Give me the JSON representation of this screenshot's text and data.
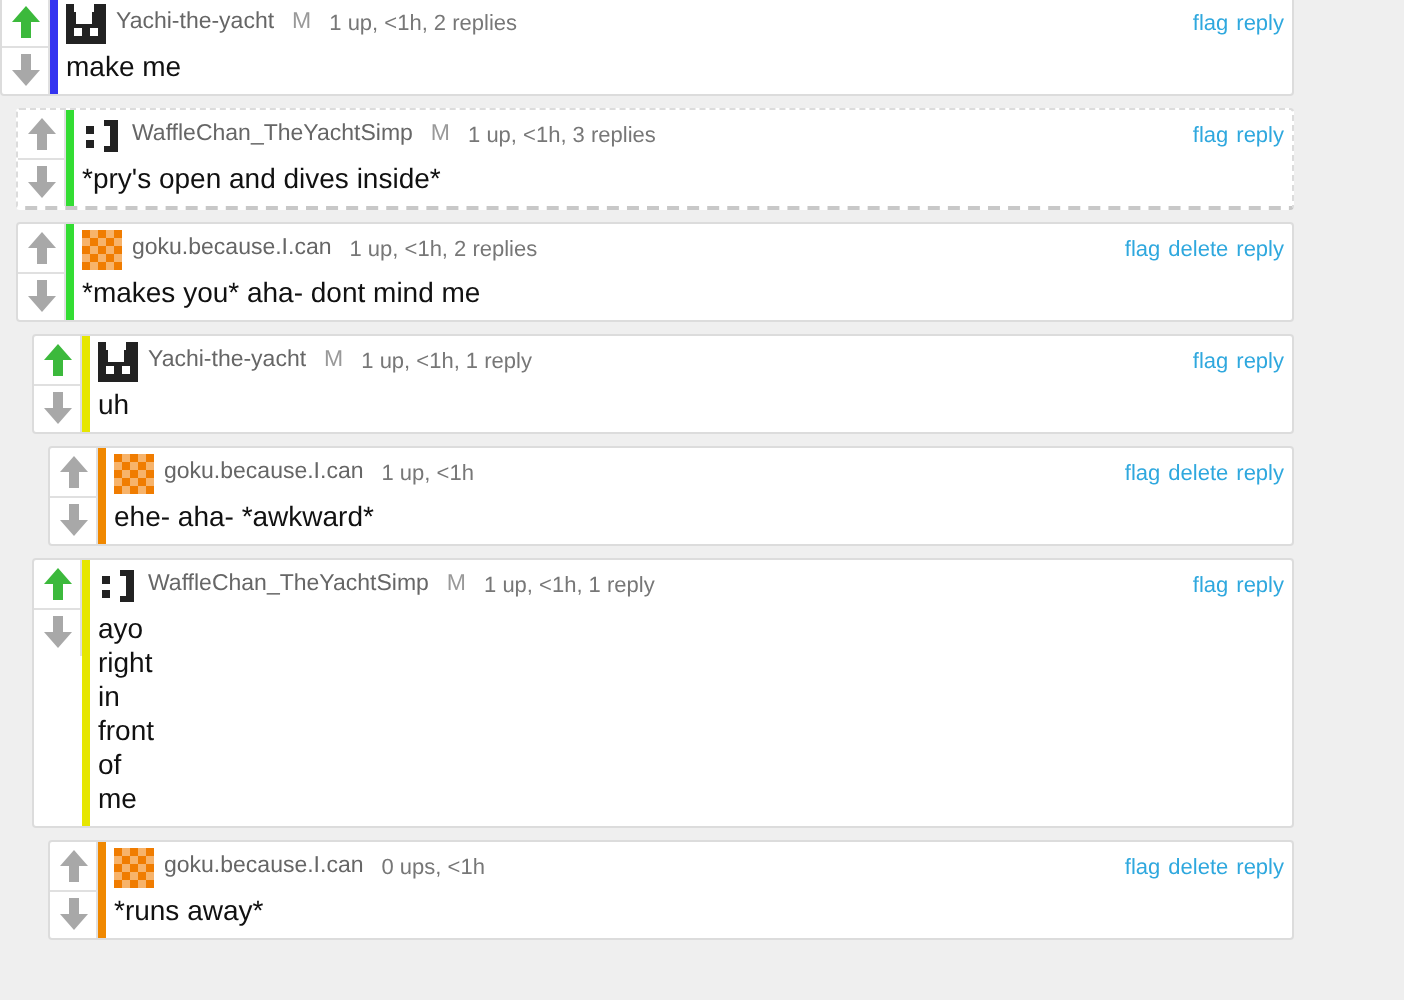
{
  "comments": [
    {
      "kind": "blocks",
      "user": "Yachi-the-yacht",
      "mod": "M",
      "meta": "1 up, <1h, 2 replies",
      "upvoted": true,
      "color": "#3434f0",
      "dashed": false,
      "actions": [
        "flag",
        "reply"
      ],
      "lines": [
        "make me"
      ],
      "children": [
        {
          "kind": "dots",
          "user": "WaffleChan_TheYachtSimp",
          "mod": "M",
          "meta": "1 up, <1h, 3 replies",
          "upvoted": false,
          "color": "#33dd33",
          "dashed": true,
          "actions": [
            "flag",
            "reply"
          ],
          "lines": [
            "*pry's open and dives inside*"
          ]
        },
        {
          "kind": "checker",
          "user": "goku.because.I.can",
          "meta": "1 up, <1h, 2 replies",
          "upvoted": false,
          "color": "#33dd33",
          "dashed": false,
          "actions": [
            "flag",
            "delete",
            "reply"
          ],
          "lines": [
            "*makes you* aha- dont mind me"
          ],
          "children": [
            {
              "kind": "blocks",
              "user": "Yachi-the-yacht",
              "mod": "M",
              "meta": "1 up, <1h, 1 reply",
              "upvoted": true,
              "color": "#e6e600",
              "dashed": false,
              "actions": [
                "flag",
                "reply"
              ],
              "lines": [
                "uh"
              ],
              "children": [
                {
                  "kind": "checker",
                  "user": "goku.because.I.can",
                  "meta": "1 up, <1h",
                  "upvoted": false,
                  "color": "#f08800",
                  "dashed": false,
                  "actions": [
                    "flag",
                    "delete",
                    "reply"
                  ],
                  "lines": [
                    "ehe- aha- *awkward*"
                  ]
                }
              ]
            },
            {
              "kind": "dots",
              "user": "WaffleChan_TheYachtSimp",
              "mod": "M",
              "meta": "1 up, <1h, 1 reply",
              "upvoted": true,
              "color": "#e6e600",
              "dashed": false,
              "actions": [
                "flag",
                "reply"
              ],
              "lines": [
                "ayo",
                "right",
                "in",
                "front",
                "of",
                "me"
              ],
              "children": [
                {
                  "kind": "checker",
                  "user": "goku.because.I.can",
                  "meta": "0 ups, <1h",
                  "upvoted": false,
                  "color": "#f08800",
                  "dashed": false,
                  "actions": [
                    "flag",
                    "delete",
                    "reply"
                  ],
                  "lines": [
                    "*runs away*"
                  ]
                }
              ]
            }
          ]
        }
      ]
    }
  ]
}
